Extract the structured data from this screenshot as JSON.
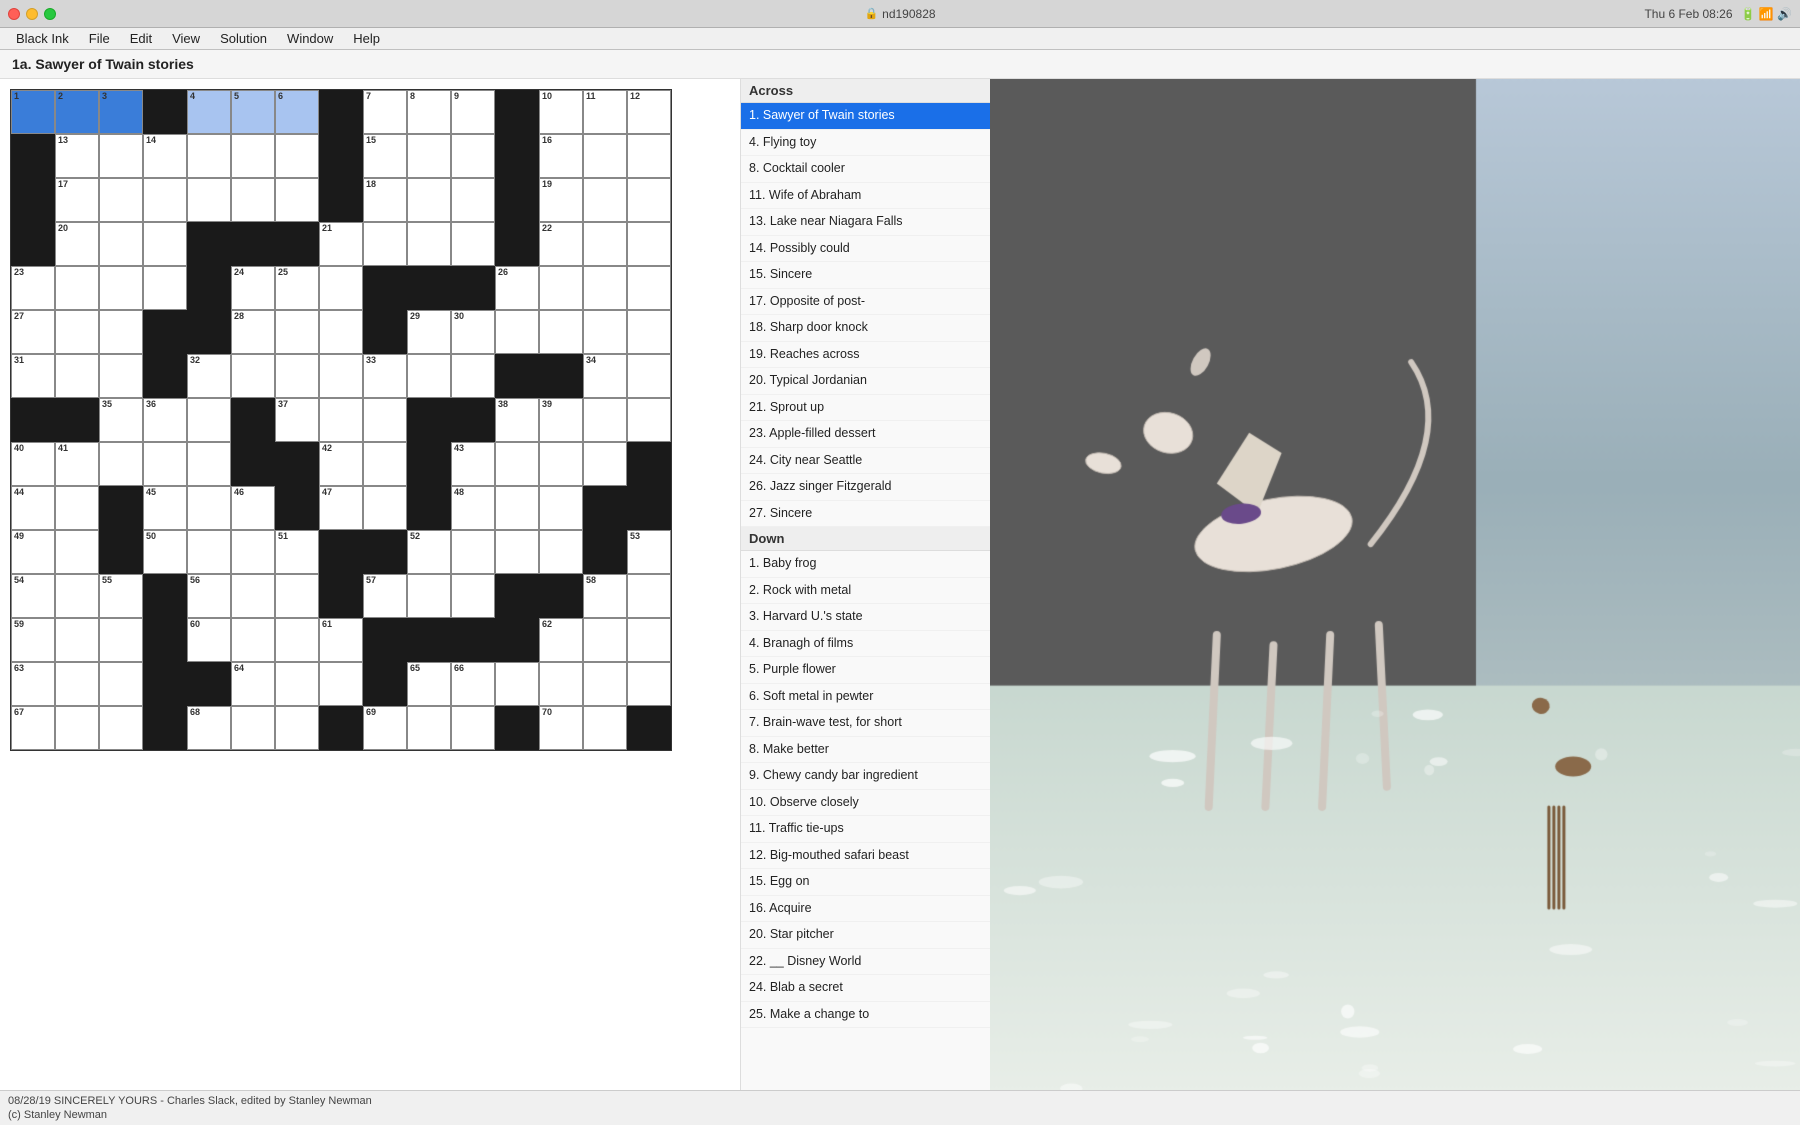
{
  "window": {
    "title": "nd190828",
    "app": "Black Ink",
    "time": "Thu 6 Feb  08:26"
  },
  "menu": {
    "app_name": "Black Ink",
    "items": [
      "File",
      "Edit",
      "View",
      "Solution",
      "Window",
      "Help"
    ]
  },
  "puzzle": {
    "title": "1a. Sawyer of Twain stories",
    "credit": "08/28/19  SINCERELY YOURS - Charles Slack, edited by Stanley Newman",
    "copyright": "(c) Stanley Newman"
  },
  "clues": {
    "across_header": "Across",
    "down_header": "Down",
    "across": [
      {
        "num": "1",
        "text": "Sawyer of Twain stories",
        "active": true
      },
      {
        "num": "4",
        "text": "Flying toy"
      },
      {
        "num": "8",
        "text": "Cocktail cooler"
      },
      {
        "num": "11",
        "text": "Wife of Abraham"
      },
      {
        "num": "13",
        "text": "Lake near Niagara Falls"
      },
      {
        "num": "14",
        "text": "Possibly could"
      },
      {
        "num": "15",
        "text": "Sincere"
      },
      {
        "num": "17",
        "text": "Opposite of post-"
      },
      {
        "num": "18",
        "text": "Sharp door knock"
      },
      {
        "num": "19",
        "text": "Reaches across"
      },
      {
        "num": "20",
        "text": "Typical Jordanian"
      },
      {
        "num": "21",
        "text": "Sprout up"
      },
      {
        "num": "23",
        "text": "Apple-filled dessert"
      },
      {
        "num": "24",
        "text": "City near Seattle"
      },
      {
        "num": "26",
        "text": "Jazz singer Fitzgerald"
      },
      {
        "num": "27",
        "text": "Sincere"
      },
      {
        "num": "29",
        "text": ""
      },
      {
        "num": "30",
        "text": ""
      },
      {
        "num": "31",
        "text": ""
      },
      {
        "num": "32",
        "text": ""
      },
      {
        "num": "33",
        "text": ""
      },
      {
        "num": "34",
        "text": ""
      },
      {
        "num": "35",
        "text": ""
      },
      {
        "num": "36",
        "text": ""
      },
      {
        "num": "37",
        "text": ""
      },
      {
        "num": "38",
        "text": ""
      },
      {
        "num": "42",
        "text": ""
      },
      {
        "num": "43",
        "text": ""
      },
      {
        "num": "44",
        "text": ""
      },
      {
        "num": "46",
        "text": ""
      },
      {
        "num": "47",
        "text": ""
      },
      {
        "num": "48",
        "text": ""
      },
      {
        "num": "50",
        "text": ""
      },
      {
        "num": "51",
        "text": ""
      },
      {
        "num": "52",
        "text": ""
      },
      {
        "num": "53",
        "text": ""
      },
      {
        "num": "54",
        "text": ""
      },
      {
        "num": "55",
        "text": ""
      },
      {
        "num": "56",
        "text": ""
      },
      {
        "num": "57",
        "text": ""
      },
      {
        "num": "58",
        "text": ""
      },
      {
        "num": "59",
        "text": ""
      },
      {
        "num": "62",
        "text": ""
      },
      {
        "num": "63",
        "text": ""
      },
      {
        "num": "64",
        "text": ""
      },
      {
        "num": "65",
        "text": ""
      },
      {
        "num": "66",
        "text": ""
      },
      {
        "num": "67",
        "text": ""
      },
      {
        "num": "68",
        "text": ""
      }
    ],
    "down": [
      {
        "num": "1",
        "text": "Baby frog"
      },
      {
        "num": "2",
        "text": "Rock with metal"
      },
      {
        "num": "3",
        "text": "Harvard U.'s state"
      },
      {
        "num": "4",
        "text": "Branagh of films"
      },
      {
        "num": "5",
        "text": "Purple flower"
      },
      {
        "num": "6",
        "text": "Soft metal in pewter"
      },
      {
        "num": "7",
        "text": "Brain-wave test, for short"
      },
      {
        "num": "8",
        "text": "Make better"
      },
      {
        "num": "9",
        "text": "Chewy candy bar ingredient"
      },
      {
        "num": "10",
        "text": "Observe closely"
      },
      {
        "num": "11",
        "text": "Traffic tie-ups"
      },
      {
        "num": "12",
        "text": "Big-mouthed safari beast"
      },
      {
        "num": "15",
        "text": "Egg on"
      },
      {
        "num": "16",
        "text": "Acquire"
      },
      {
        "num": "20",
        "text": "Star pitcher"
      },
      {
        "num": "22",
        "text": "__ Disney World"
      },
      {
        "num": "24",
        "text": "Blab a secret"
      },
      {
        "num": "25",
        "text": "Make a change to"
      }
    ]
  },
  "grid": {
    "cols": 15,
    "rows": 15,
    "cell_size": 44,
    "black_cells": [
      [
        0,
        3
      ],
      [
        0,
        7
      ],
      [
        0,
        11
      ],
      [
        1,
        0
      ],
      [
        1,
        7
      ],
      [
        1,
        11
      ],
      [
        2,
        0
      ],
      [
        2,
        7
      ],
      [
        2,
        11
      ],
      [
        3,
        0
      ],
      [
        3,
        4
      ],
      [
        3,
        5
      ],
      [
        3,
        6
      ],
      [
        3,
        11
      ],
      [
        4,
        4
      ],
      [
        4,
        8
      ],
      [
        4,
        9
      ],
      [
        4,
        10
      ],
      [
        5,
        3
      ],
      [
        5,
        4
      ],
      [
        5,
        8
      ],
      [
        6,
        3
      ],
      [
        6,
        11
      ],
      [
        6,
        12
      ],
      [
        7,
        0
      ],
      [
        7,
        1
      ],
      [
        7,
        5
      ],
      [
        7,
        9
      ],
      [
        7,
        10
      ],
      [
        8,
        5
      ],
      [
        8,
        6
      ],
      [
        8,
        9
      ],
      [
        8,
        14
      ],
      [
        9,
        2
      ],
      [
        9,
        6
      ],
      [
        9,
        9
      ],
      [
        9,
        13
      ],
      [
        9,
        14
      ],
      [
        10,
        2
      ],
      [
        10,
        7
      ],
      [
        10,
        8
      ],
      [
        10,
        13
      ],
      [
        11,
        3
      ],
      [
        11,
        7
      ],
      [
        11,
        11
      ],
      [
        11,
        12
      ],
      [
        12,
        3
      ],
      [
        12,
        8
      ],
      [
        12,
        9
      ],
      [
        12,
        10
      ],
      [
        12,
        11
      ],
      [
        13,
        3
      ],
      [
        13,
        4
      ],
      [
        13,
        8
      ],
      [
        14,
        3
      ],
      [
        14,
        7
      ],
      [
        14,
        11
      ],
      [
        14,
        14
      ]
    ]
  }
}
